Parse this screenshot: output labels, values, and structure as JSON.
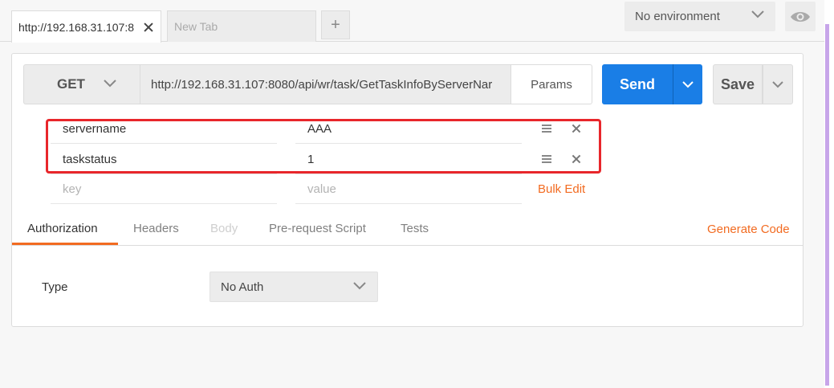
{
  "tabs": [
    {
      "label": "http://192.168.31.107:8"
    },
    {
      "label": "New Tab"
    }
  ],
  "new_tab_symbol": "+",
  "environment": {
    "selected": "No environment"
  },
  "request": {
    "method": "GET",
    "url": "http://192.168.31.107:8080/api/wr/task/GetTaskInfoByServerNar",
    "params_label": "Params",
    "send_label": "Send",
    "save_label": "Save"
  },
  "params": {
    "rows": [
      {
        "key": "servername",
        "value": "AAA"
      },
      {
        "key": "taskstatus",
        "value": "1"
      }
    ],
    "key_placeholder": "key",
    "value_placeholder": "value",
    "bulk_edit_label": "Bulk Edit"
  },
  "subtabs": [
    "Authorization",
    "Headers",
    "Body",
    "Pre-request Script",
    "Tests"
  ],
  "generate_code_label": "Generate Code",
  "auth": {
    "type_label": "Type",
    "selected": "No Auth"
  },
  "colors": {
    "accent": "#f26b21",
    "send": "#1a7ee6",
    "highlight": "#e8262b"
  },
  "icons": [
    "close-icon",
    "plus-icon",
    "chevron-down-icon",
    "eye-icon",
    "drag-handle-icon"
  ]
}
